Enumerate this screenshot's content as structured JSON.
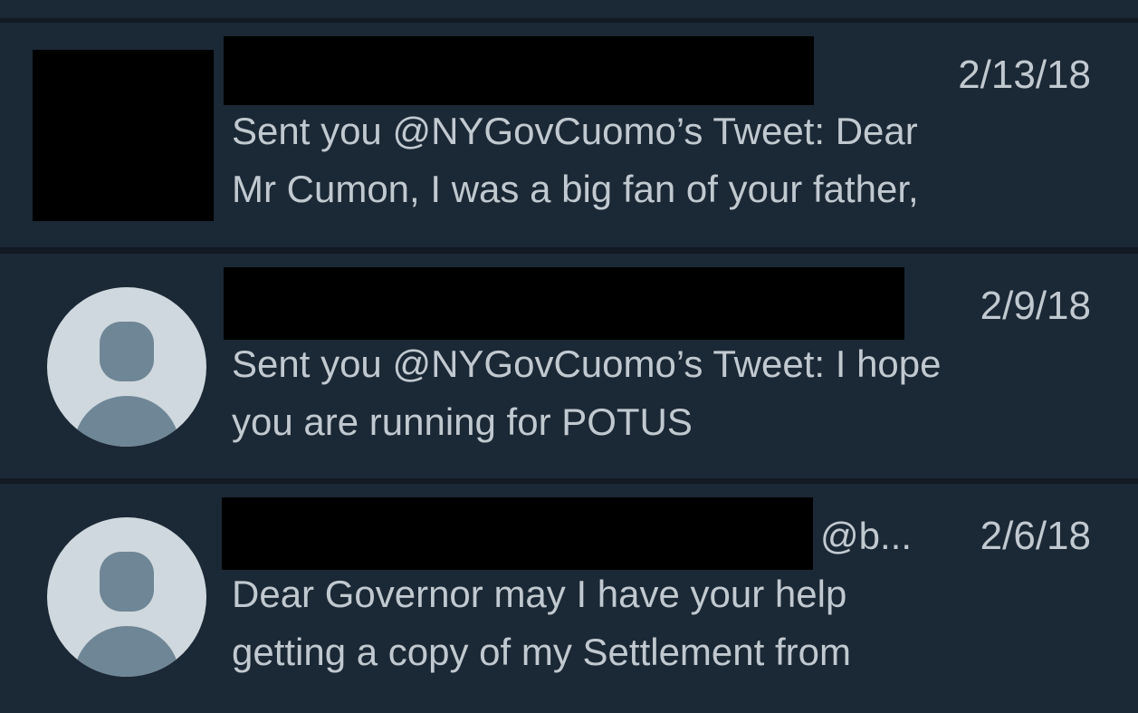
{
  "messages": [
    {
      "date": "2/13/18",
      "line1": "Sent you @NYGovCuomo’s Tweet: Dear",
      "line2": "Mr Cumon, I was a big fan of your father,",
      "avatar": "redacted-square"
    },
    {
      "date": "2/9/18",
      "line1": "Sent you @NYGovCuomo’s Tweet: I hope",
      "line2": "you are running for POTUS",
      "avatar": "default-profile-icon"
    },
    {
      "date": "2/6/18",
      "handle": "@b...",
      "line1": "Dear Governor may I have your help",
      "line2": "getting a copy of my Settlement from",
      "avatar": "default-profile-icon"
    }
  ],
  "colors": {
    "background": "#141d26",
    "row": "#1b2835",
    "text": "#c1c9d0",
    "avatar_bg": "#cfd8de",
    "avatar_fg": "#6f8696",
    "redaction": "#000000"
  }
}
